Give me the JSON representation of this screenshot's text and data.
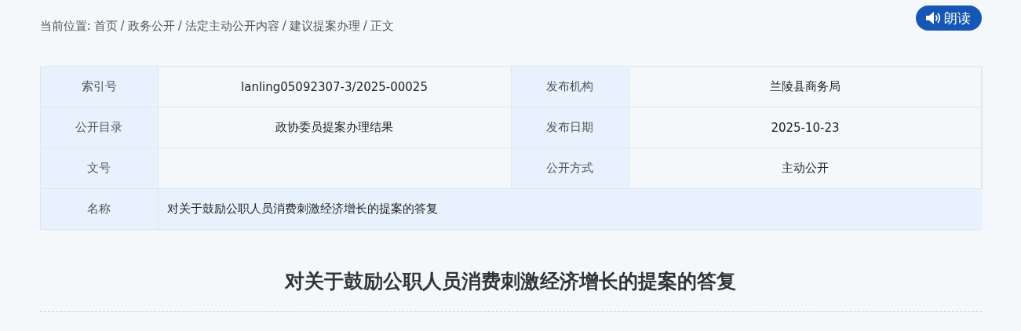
{
  "breadcrumb": {
    "label": "当前位置:",
    "separator": "/",
    "items": [
      "首页",
      "政务公开",
      "法定主动公开内容",
      "建议提案办理",
      "正文"
    ]
  },
  "read_aloud_button": {
    "label": "朗读"
  },
  "info_table": {
    "rows": [
      [
        {
          "label": "索引号",
          "value": "lanling05092307-3/2025-00025"
        },
        {
          "label": "发布机构",
          "value": "兰陵县商务局"
        }
      ],
      [
        {
          "label": "公开目录",
          "value": "政协委员提案办理结果"
        },
        {
          "label": "发布日期",
          "value": "2025-10-23"
        }
      ],
      [
        {
          "label": "文号"
        },
        {
          "label": "公开方式",
          "value": "主动公开"
        }
      ]
    ],
    "name_row": {
      "label": "名称",
      "value": "对关于鼓励公职人员消费刺激经济增长的提案的答复"
    }
  },
  "article": {
    "title": "对关于鼓励公职人员消费刺激经济增长的提案的答复"
  }
}
